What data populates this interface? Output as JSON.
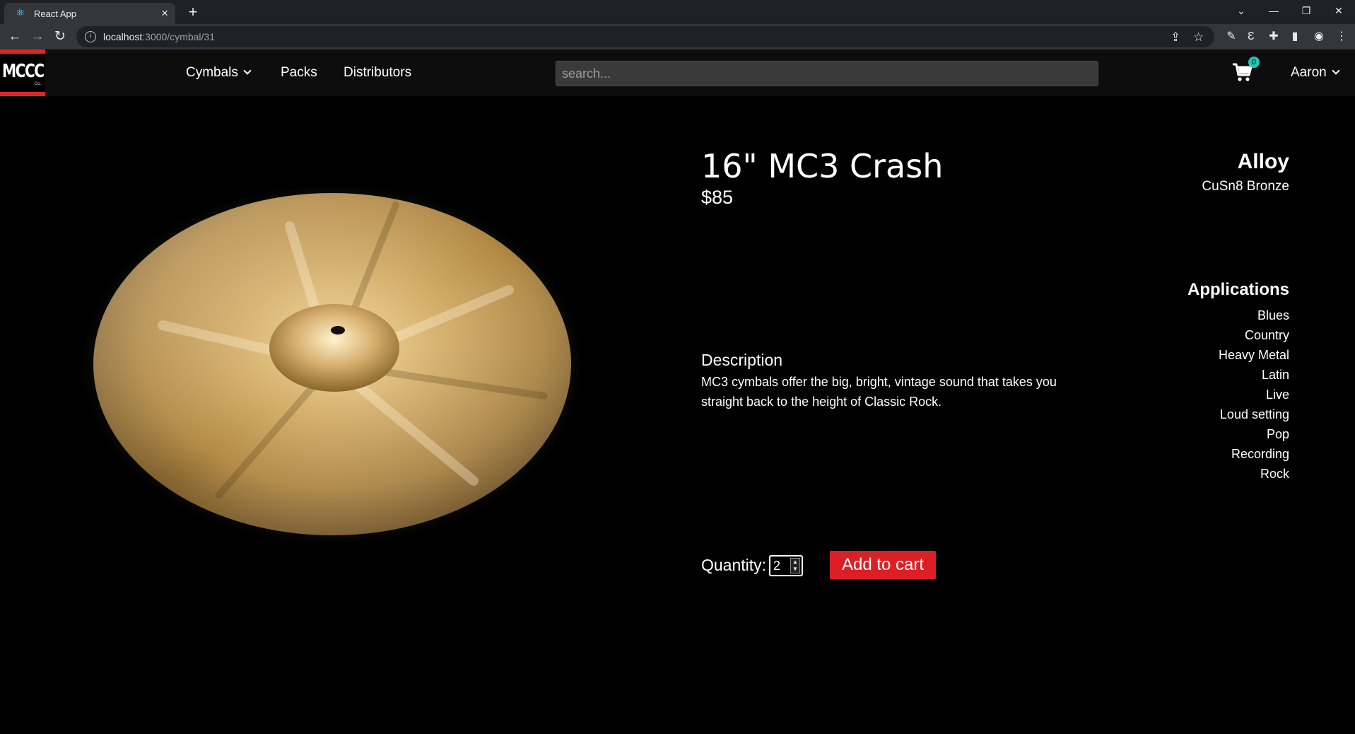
{
  "browser": {
    "tab_title": "React App",
    "url_host": "localhost",
    "url_path": ":3000/cymbal/31"
  },
  "nav": {
    "logo_text": "MCCC",
    "logo_sub": "Co.",
    "links": [
      "Cymbals",
      "Packs",
      "Distributors"
    ],
    "search_placeholder": "search...",
    "cart_count": "0",
    "user_name": "Aaron"
  },
  "product": {
    "title": "16\" MC3 Crash",
    "price": "$85",
    "description_heading": "Description",
    "description": "MC3 cymbals offer the big, bright, vintage sound that takes you straight back to the height of Classic Rock.",
    "quantity_label": "Quantity:",
    "quantity_value": "2",
    "add_to_cart_label": "Add to cart",
    "alloy_heading": "Alloy",
    "alloy_value": "CuSn8 Bronze",
    "applications_heading": "Applications",
    "applications": [
      "Blues",
      "Country",
      "Heavy Metal",
      "Latin",
      "Live",
      "Loud setting",
      "Pop",
      "Recording",
      "Rock"
    ]
  },
  "colors": {
    "accent_red": "#dc1f26",
    "badge_teal": "#1fc7b6",
    "navbar_bg": "#0d0d0d",
    "page_bg": "#000000",
    "cymbal_gold": "#c9a35e"
  }
}
